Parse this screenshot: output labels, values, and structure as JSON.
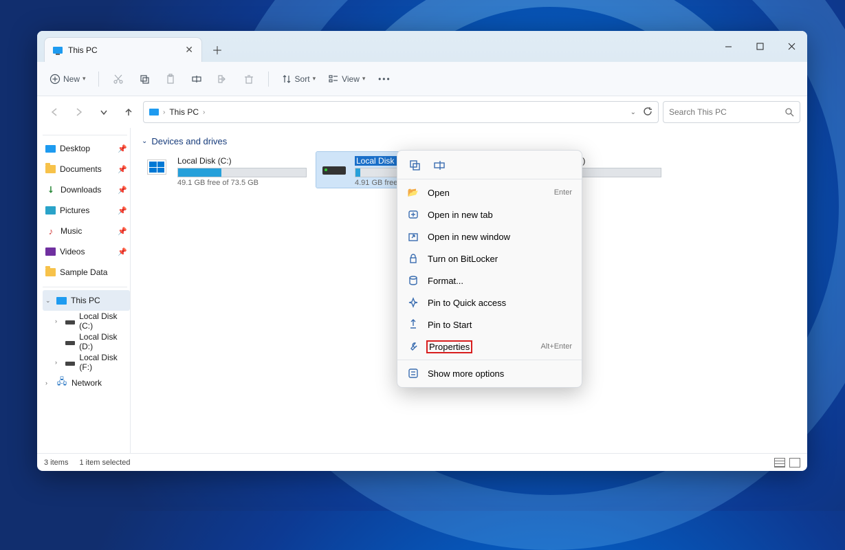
{
  "tab": {
    "title": "This PC"
  },
  "toolbar": {
    "new": "New",
    "sort": "Sort",
    "view": "View"
  },
  "breadcrumb": {
    "root": "This PC"
  },
  "search": {
    "placeholder": "Search This PC"
  },
  "sidebar": {
    "quick": [
      {
        "label": "Desktop",
        "icon": "desktop",
        "pinned": true
      },
      {
        "label": "Documents",
        "icon": "folder",
        "pinned": true
      },
      {
        "label": "Downloads",
        "icon": "down",
        "pinned": true
      },
      {
        "label": "Pictures",
        "icon": "pic",
        "pinned": true
      },
      {
        "label": "Music",
        "icon": "music",
        "pinned": true
      },
      {
        "label": "Videos",
        "icon": "video",
        "pinned": true
      },
      {
        "label": "Sample Data",
        "icon": "folder",
        "pinned": false
      }
    ],
    "thispc": "This PC",
    "drives": [
      {
        "label": "Local Disk (C:)"
      },
      {
        "label": "Local Disk (D:)"
      },
      {
        "label": "Local Disk (F:)"
      }
    ],
    "network": "Network"
  },
  "group_header": "Devices and drives",
  "drives": [
    {
      "name": "Local Disk (C:)",
      "free": "49.1 GB free of 73.5 GB",
      "fill_pct": 34,
      "type": "os"
    },
    {
      "name": "Local Disk (D:)",
      "free": "4.91 GB free of 4.9",
      "fill_pct": 4,
      "type": "hdd",
      "selected": true
    },
    {
      "name": "Local Disk (F:)",
      "free": "",
      "fill_pct": 0,
      "type": "hdd"
    }
  ],
  "status": {
    "items": "3 items",
    "selected": "1 item selected"
  },
  "context_menu": {
    "open": {
      "label": "Open",
      "accel": "Enter"
    },
    "open_tab": {
      "label": "Open in new tab"
    },
    "open_window": {
      "label": "Open in new window"
    },
    "bitlocker": {
      "label": "Turn on BitLocker"
    },
    "format": {
      "label": "Format..."
    },
    "pin_quick": {
      "label": "Pin to Quick access"
    },
    "pin_start": {
      "label": "Pin to Start"
    },
    "properties": {
      "label": "Properties",
      "accel": "Alt+Enter"
    },
    "more": {
      "label": "Show more options"
    }
  }
}
